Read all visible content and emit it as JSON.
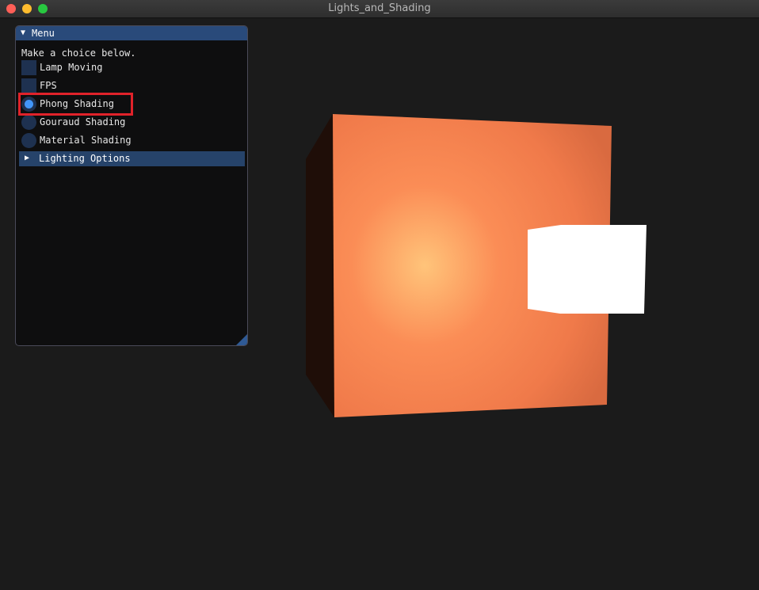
{
  "window": {
    "title": "Lights_and_Shading"
  },
  "menu": {
    "title": "Menu",
    "instruction": "Make a choice below.",
    "checkboxes": [
      {
        "label": "Lamp Moving",
        "checked": false
      },
      {
        "label": "FPS",
        "checked": false
      }
    ],
    "radios": [
      {
        "label": "Phong Shading",
        "selected": true
      },
      {
        "label": "Gouraud Shading",
        "selected": false
      },
      {
        "label": "Material Shading",
        "selected": false
      }
    ],
    "section": {
      "label": "Lighting Options",
      "expanded": false
    }
  },
  "colors": {
    "background": "#1b1b1b",
    "cube_base": "#f07a4a",
    "specular_highlight": "#ffc47a",
    "lamp": "#ffffff",
    "radio_selected": "#4296fa",
    "highlight_border": "#e0222a"
  }
}
